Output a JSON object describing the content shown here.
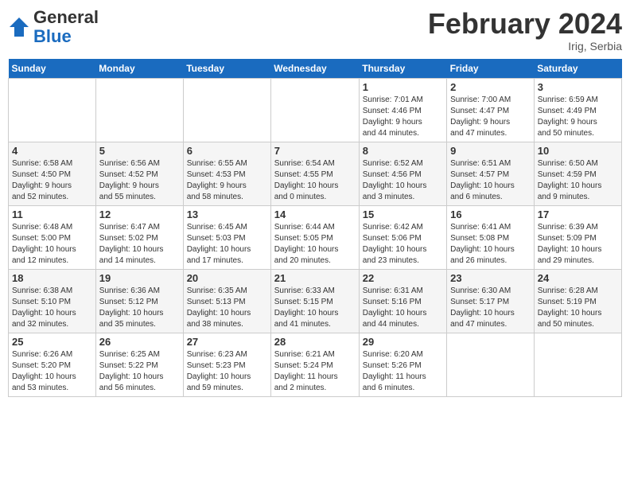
{
  "header": {
    "logo_general": "General",
    "logo_blue": "Blue",
    "month_title": "February 2024",
    "subtitle": "Irig, Serbia"
  },
  "days_of_week": [
    "Sunday",
    "Monday",
    "Tuesday",
    "Wednesday",
    "Thursday",
    "Friday",
    "Saturday"
  ],
  "weeks": [
    [
      {
        "day": "",
        "info": ""
      },
      {
        "day": "",
        "info": ""
      },
      {
        "day": "",
        "info": ""
      },
      {
        "day": "",
        "info": ""
      },
      {
        "day": "1",
        "info": "Sunrise: 7:01 AM\nSunset: 4:46 PM\nDaylight: 9 hours\nand 44 minutes."
      },
      {
        "day": "2",
        "info": "Sunrise: 7:00 AM\nSunset: 4:47 PM\nDaylight: 9 hours\nand 47 minutes."
      },
      {
        "day": "3",
        "info": "Sunrise: 6:59 AM\nSunset: 4:49 PM\nDaylight: 9 hours\nand 50 minutes."
      }
    ],
    [
      {
        "day": "4",
        "info": "Sunrise: 6:58 AM\nSunset: 4:50 PM\nDaylight: 9 hours\nand 52 minutes."
      },
      {
        "day": "5",
        "info": "Sunrise: 6:56 AM\nSunset: 4:52 PM\nDaylight: 9 hours\nand 55 minutes."
      },
      {
        "day": "6",
        "info": "Sunrise: 6:55 AM\nSunset: 4:53 PM\nDaylight: 9 hours\nand 58 minutes."
      },
      {
        "day": "7",
        "info": "Sunrise: 6:54 AM\nSunset: 4:55 PM\nDaylight: 10 hours\nand 0 minutes."
      },
      {
        "day": "8",
        "info": "Sunrise: 6:52 AM\nSunset: 4:56 PM\nDaylight: 10 hours\nand 3 minutes."
      },
      {
        "day": "9",
        "info": "Sunrise: 6:51 AM\nSunset: 4:57 PM\nDaylight: 10 hours\nand 6 minutes."
      },
      {
        "day": "10",
        "info": "Sunrise: 6:50 AM\nSunset: 4:59 PM\nDaylight: 10 hours\nand 9 minutes."
      }
    ],
    [
      {
        "day": "11",
        "info": "Sunrise: 6:48 AM\nSunset: 5:00 PM\nDaylight: 10 hours\nand 12 minutes."
      },
      {
        "day": "12",
        "info": "Sunrise: 6:47 AM\nSunset: 5:02 PM\nDaylight: 10 hours\nand 14 minutes."
      },
      {
        "day": "13",
        "info": "Sunrise: 6:45 AM\nSunset: 5:03 PM\nDaylight: 10 hours\nand 17 minutes."
      },
      {
        "day": "14",
        "info": "Sunrise: 6:44 AM\nSunset: 5:05 PM\nDaylight: 10 hours\nand 20 minutes."
      },
      {
        "day": "15",
        "info": "Sunrise: 6:42 AM\nSunset: 5:06 PM\nDaylight: 10 hours\nand 23 minutes."
      },
      {
        "day": "16",
        "info": "Sunrise: 6:41 AM\nSunset: 5:08 PM\nDaylight: 10 hours\nand 26 minutes."
      },
      {
        "day": "17",
        "info": "Sunrise: 6:39 AM\nSunset: 5:09 PM\nDaylight: 10 hours\nand 29 minutes."
      }
    ],
    [
      {
        "day": "18",
        "info": "Sunrise: 6:38 AM\nSunset: 5:10 PM\nDaylight: 10 hours\nand 32 minutes."
      },
      {
        "day": "19",
        "info": "Sunrise: 6:36 AM\nSunset: 5:12 PM\nDaylight: 10 hours\nand 35 minutes."
      },
      {
        "day": "20",
        "info": "Sunrise: 6:35 AM\nSunset: 5:13 PM\nDaylight: 10 hours\nand 38 minutes."
      },
      {
        "day": "21",
        "info": "Sunrise: 6:33 AM\nSunset: 5:15 PM\nDaylight: 10 hours\nand 41 minutes."
      },
      {
        "day": "22",
        "info": "Sunrise: 6:31 AM\nSunset: 5:16 PM\nDaylight: 10 hours\nand 44 minutes."
      },
      {
        "day": "23",
        "info": "Sunrise: 6:30 AM\nSunset: 5:17 PM\nDaylight: 10 hours\nand 47 minutes."
      },
      {
        "day": "24",
        "info": "Sunrise: 6:28 AM\nSunset: 5:19 PM\nDaylight: 10 hours\nand 50 minutes."
      }
    ],
    [
      {
        "day": "25",
        "info": "Sunrise: 6:26 AM\nSunset: 5:20 PM\nDaylight: 10 hours\nand 53 minutes."
      },
      {
        "day": "26",
        "info": "Sunrise: 6:25 AM\nSunset: 5:22 PM\nDaylight: 10 hours\nand 56 minutes."
      },
      {
        "day": "27",
        "info": "Sunrise: 6:23 AM\nSunset: 5:23 PM\nDaylight: 10 hours\nand 59 minutes."
      },
      {
        "day": "28",
        "info": "Sunrise: 6:21 AM\nSunset: 5:24 PM\nDaylight: 11 hours\nand 2 minutes."
      },
      {
        "day": "29",
        "info": "Sunrise: 6:20 AM\nSunset: 5:26 PM\nDaylight: 11 hours\nand 6 minutes."
      },
      {
        "day": "",
        "info": ""
      },
      {
        "day": "",
        "info": ""
      }
    ]
  ]
}
